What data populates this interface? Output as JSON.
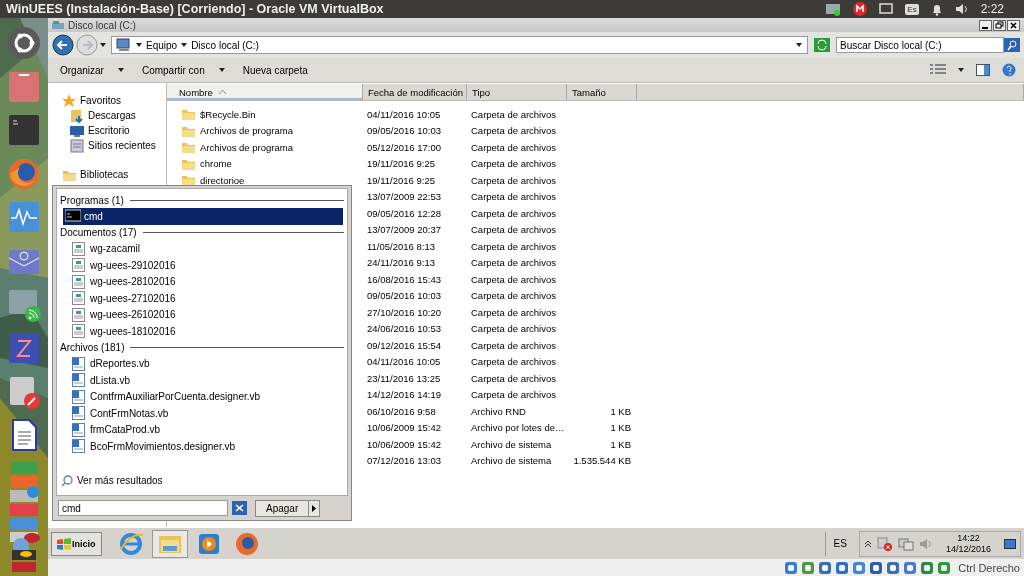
{
  "top_bar": {
    "title": "WinUEES (Instalación-Base) [Corriendo] - Oracle VM VirtualBox",
    "keyboard": "Es",
    "time": "2:22"
  },
  "window": {
    "title": "Disco local (C:)"
  },
  "address_bar": {
    "breadcrumb": [
      "Equipo",
      "Disco local (C:)"
    ],
    "search": {
      "placeholder": "Buscar Disco local (C:)"
    }
  },
  "toolbar": [
    {
      "label": "Organizar",
      "kind": "menu"
    },
    {
      "label": "Compartir con",
      "kind": "menu"
    },
    {
      "label": "Nueva carpeta",
      "kind": "button"
    }
  ],
  "nav": [
    {
      "label": "Favoritos",
      "kind": "group"
    },
    {
      "label": "Descargas",
      "kind": "item"
    },
    {
      "label": "Escritorio",
      "kind": "item"
    },
    {
      "label": "Sitios recientes",
      "kind": "item"
    },
    {
      "label": "Bibliotecas",
      "kind": "group"
    }
  ],
  "table": {
    "columns": [
      {
        "label": "Nombre",
        "sorted": true
      },
      {
        "label": "Fecha de modificación",
        "sorted": false
      },
      {
        "label": "Tipo",
        "sorted": false
      },
      {
        "label": "Tamaño",
        "sorted": false
      }
    ],
    "rows": [
      {
        "name": "$Recycle.Bin",
        "modified": "04/11/2016 10:05",
        "type": "Carpeta de archivos"
      },
      {
        "name": "Archivos de programa",
        "modified": "09/05/2016 10:03",
        "type": "Carpeta de archivos"
      },
      {
        "name": "Archivos de programa",
        "modified": "05/12/2016 17:00",
        "type": "Carpeta de archivos"
      },
      {
        "name": "chrome",
        "modified": "19/11/2016 9:25",
        "type": "Carpeta de archivos"
      },
      {
        "name": "directorioe",
        "modified": "19/11/2016 9:25",
        "type": "Carpeta de archivos"
      },
      {
        "modified": "13/07/2009 22:53",
        "type": "Carpeta de archivos"
      },
      {
        "modified": "09/05/2016 12:28",
        "type": "Carpeta de archivos"
      },
      {
        "modified": "13/07/2009 20:37",
        "type": "Carpeta de archivos"
      },
      {
        "modified": "11/05/2016 8:13",
        "type": "Carpeta de archivos"
      },
      {
        "modified": "24/11/2016 9:13",
        "type": "Carpeta de archivos"
      },
      {
        "modified": "16/08/2016 15:43",
        "type": "Carpeta de archivos"
      },
      {
        "modified": "09/05/2016 10:03",
        "type": "Carpeta de archivos"
      },
      {
        "modified": "27/10/2016 10:20",
        "type": "Carpeta de archivos"
      },
      {
        "modified": "24/06/2016 10:53",
        "type": "Carpeta de archivos"
      },
      {
        "modified": "09/12/2016 15:54",
        "type": "Carpeta de archivos"
      },
      {
        "modified": "04/11/2016 10:05",
        "type": "Carpeta de archivos"
      },
      {
        "modified": "23/11/2016 13:25",
        "type": "Carpeta de archivos"
      },
      {
        "modified": "14/12/2016 14:19",
        "type": "Carpeta de archivos"
      },
      {
        "modified": "06/10/2016 9:58",
        "type": "Archivo RND",
        "size": "1 KB"
      },
      {
        "modified": "10/06/2009 15:42",
        "type": "Archivo por lotes de…",
        "size": "1 KB"
      },
      {
        "modified": "10/06/2009 15:42",
        "type": "Archivo de sistema",
        "size": "1 KB"
      },
      {
        "modified": "07/12/2016 13:03",
        "type": "Archivo de sistema",
        "size": "1.535.544 KB"
      }
    ]
  },
  "start_menu": {
    "sections": [
      {
        "title": "Programas (1)",
        "kind": "program",
        "items": [
          {
            "label": "cmd",
            "selected": true
          }
        ]
      },
      {
        "title": "Documentos (17)",
        "kind": "document",
        "items": [
          {
            "label": "wg-zacamil",
            "selected": false
          },
          {
            "label": "wg-uees-29102016",
            "selected": false
          },
          {
            "label": "wg-uees-28102016",
            "selected": false
          },
          {
            "label": "wg-uees-27102016",
            "selected": false
          },
          {
            "label": "wg-uees-26102016",
            "selected": false
          },
          {
            "label": "wg-uees-18102016",
            "selected": false
          }
        ]
      },
      {
        "title": "Archivos (181)",
        "kind": "vb",
        "items": [
          {
            "label": "dReportes.vb",
            "selected": false
          },
          {
            "label": "dLista.vb",
            "selected": false
          },
          {
            "label": "ContfrmAuxiliarPorCuenta.designer.vb",
            "selected": false
          },
          {
            "label": "ContFrmNotas.vb",
            "selected": false
          },
          {
            "label": "frmCataProd.vb",
            "selected": false
          },
          {
            "label": "BcoFrmMovimientos.designer.vb",
            "selected": false
          }
        ]
      }
    ],
    "more_results": "Ver más resultados",
    "search": {
      "value": "cmd"
    },
    "shutdown": "Apagar"
  },
  "taskbar": {
    "start": "Inicio",
    "language": "ES",
    "time": "14:22",
    "date": "14/12/2016"
  },
  "status_bar": {
    "host_key": "Ctrl Derecho"
  }
}
